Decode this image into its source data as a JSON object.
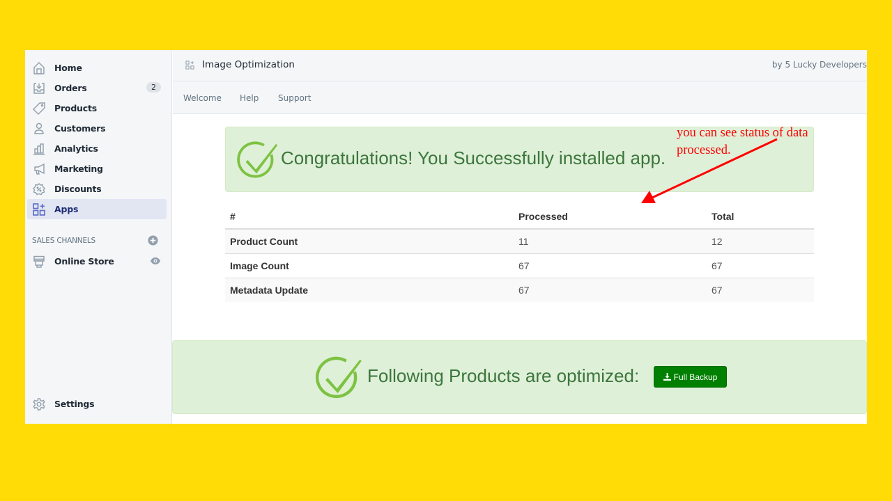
{
  "sidebar": {
    "items": [
      {
        "label": "Home",
        "icon": "home-icon"
      },
      {
        "label": "Orders",
        "icon": "orders-icon",
        "badge": "2"
      },
      {
        "label": "Products",
        "icon": "tag-icon"
      },
      {
        "label": "Customers",
        "icon": "person-icon"
      },
      {
        "label": "Analytics",
        "icon": "bar-chart-icon"
      },
      {
        "label": "Marketing",
        "icon": "megaphone-icon"
      },
      {
        "label": "Discounts",
        "icon": "discount-icon"
      },
      {
        "label": "Apps",
        "icon": "apps-icon",
        "active": true
      }
    ],
    "sales_channels": {
      "header": "SALES CHANNELS",
      "items": [
        {
          "label": "Online Store",
          "icon": "store-icon"
        }
      ]
    },
    "settings_label": "Settings"
  },
  "topbar": {
    "app_title": "Image Optimization",
    "developer": "by 5 Lucky Developers"
  },
  "subnav": {
    "links": [
      "Welcome",
      "Help",
      "Support"
    ]
  },
  "main": {
    "success_message": "Congratulations! You Successfully installed app.",
    "table": {
      "headers": [
        "#",
        "Processed",
        "Total"
      ],
      "rows": [
        {
          "name": "Product Count",
          "processed": "11",
          "total": "12"
        },
        {
          "name": "Image Count",
          "processed": "67",
          "total": "67"
        },
        {
          "name": "Metadata Update",
          "processed": "67",
          "total": "67"
        }
      ]
    },
    "optimized_message": "Following Products are optimized:",
    "backup_button": "Full Backup"
  },
  "annotation": {
    "text": "you can see status of data processed.",
    "color": "#ff0000"
  },
  "colors": {
    "page_background": "#FFDC05",
    "success_bg": "#dff0d8",
    "success_text": "#3c763d",
    "check_green": "#7dc242",
    "button_green": "#008000"
  }
}
